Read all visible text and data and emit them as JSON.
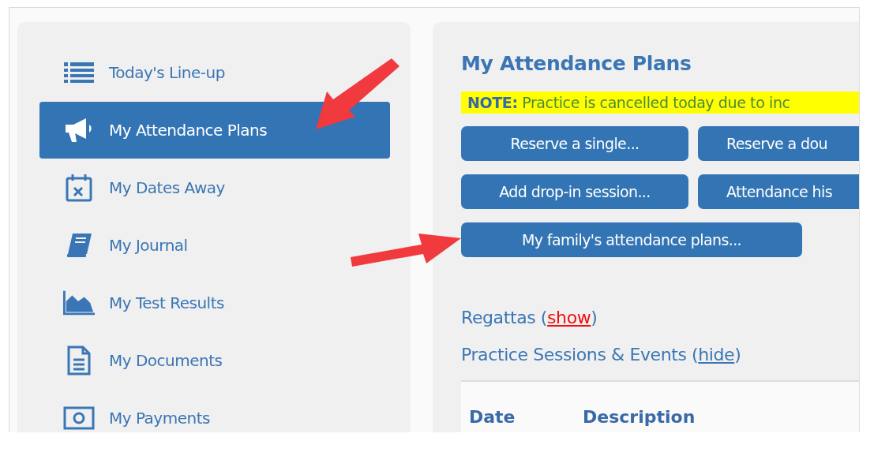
{
  "sidebar": {
    "items": [
      {
        "label": "Today's Line-up",
        "selected": false
      },
      {
        "label": "My Attendance Plans",
        "selected": true
      },
      {
        "label": "My Dates Away",
        "selected": false
      },
      {
        "label": "My Journal",
        "selected": false
      },
      {
        "label": "My Test Results",
        "selected": false
      },
      {
        "label": "My Documents",
        "selected": false
      },
      {
        "label": "My Payments",
        "selected": false
      }
    ]
  },
  "main": {
    "title": "My Attendance Plans",
    "note": "**NOTE:** Practice is cancelled today due to inc",
    "button_rows": [
      [
        "Reserve a single...",
        "Reserve a dou"
      ],
      [
        "Add drop-in session...",
        "Attendance his"
      ],
      [
        "My family's attendance plans..."
      ]
    ],
    "sections": [
      {
        "label": "Regattas (",
        "link": "show",
        "after": ")",
        "highlighted": true
      },
      {
        "label": "Practice Sessions & Events (",
        "link": "hide",
        "after": ")",
        "highlighted": false
      }
    ],
    "table": {
      "columns": [
        "Date",
        "Description"
      ]
    }
  }
}
